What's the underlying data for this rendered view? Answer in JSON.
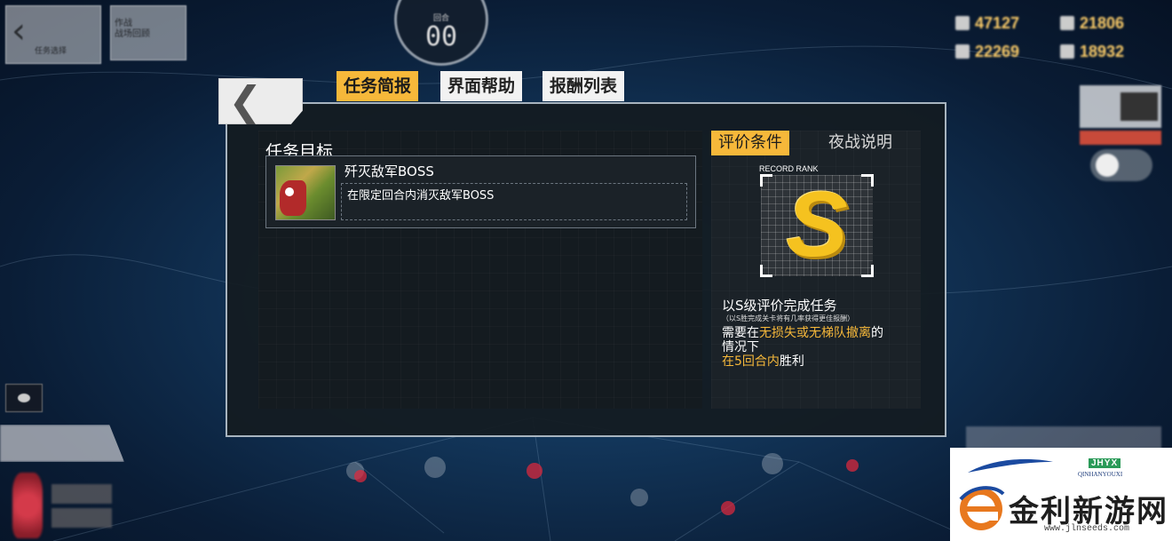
{
  "hud": {
    "back_label": "任务选择",
    "plan_label": "作战\n战场回顾",
    "turn_label": "回合",
    "turn_value": "00",
    "resources": [
      "47127",
      "21806",
      "22269",
      "18932"
    ]
  },
  "dialog": {
    "tabs": [
      "任务简报",
      "界面帮助",
      "报酬列表"
    ],
    "objective_header": "任务目标",
    "objective_name": "歼灭敌军BOSS",
    "objective_desc": "在限定回合内消灭敌军BOSS",
    "rating_tabs": [
      "评价条件",
      "夜战说明"
    ],
    "rank_caption": "RECORD RANK",
    "rank_letter": "S",
    "condition_title": "以S级评价完成任务",
    "condition_note": "（以S胜完成关卡将有几率获得更佳报酬）",
    "cond_pre": "需要在",
    "cond_hl": "无损失或无梯队撤离",
    "cond_post": "的",
    "cond_line2": "情况下",
    "cond_line3_hl": "在5回合内",
    "cond_line3_post": "胜利"
  },
  "watermark": {
    "cn": "金利新游网",
    "en_badge": "JHYX",
    "en": "QINHANYOUXI",
    "url": "www.jlnseeds.com"
  },
  "colors": {
    "accent": "#f6b83a",
    "panel_bg": "#141b20",
    "rank_gold": "#f5c21f",
    "highlight": "#f6b83a"
  }
}
